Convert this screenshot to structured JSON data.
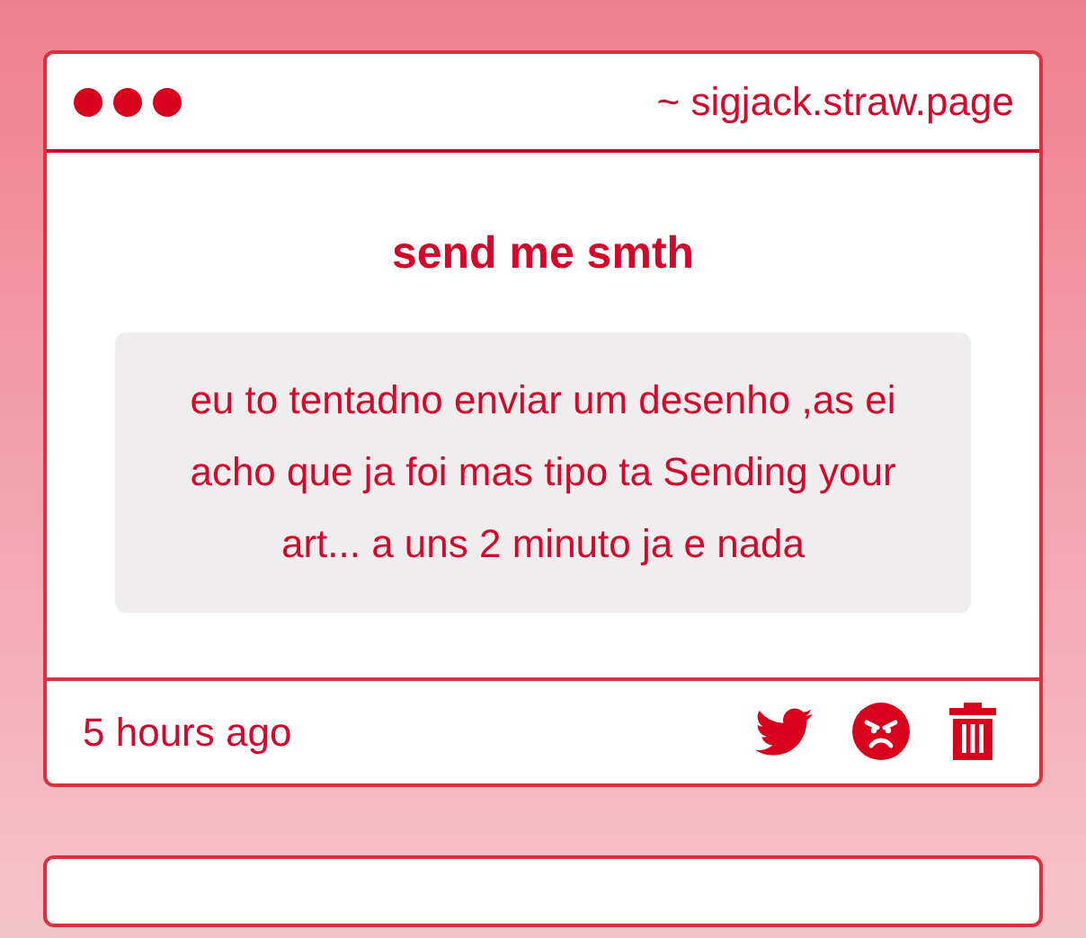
{
  "window": {
    "address": "~ sigjack.straw.page"
  },
  "message": {
    "title": "send me smth",
    "body": "eu to tentadno enviar um desenho ,as ei acho que ja foi mas tipo ta Sending your art... a uns 2 minuto ja e nada",
    "time": "5 hours ago"
  }
}
